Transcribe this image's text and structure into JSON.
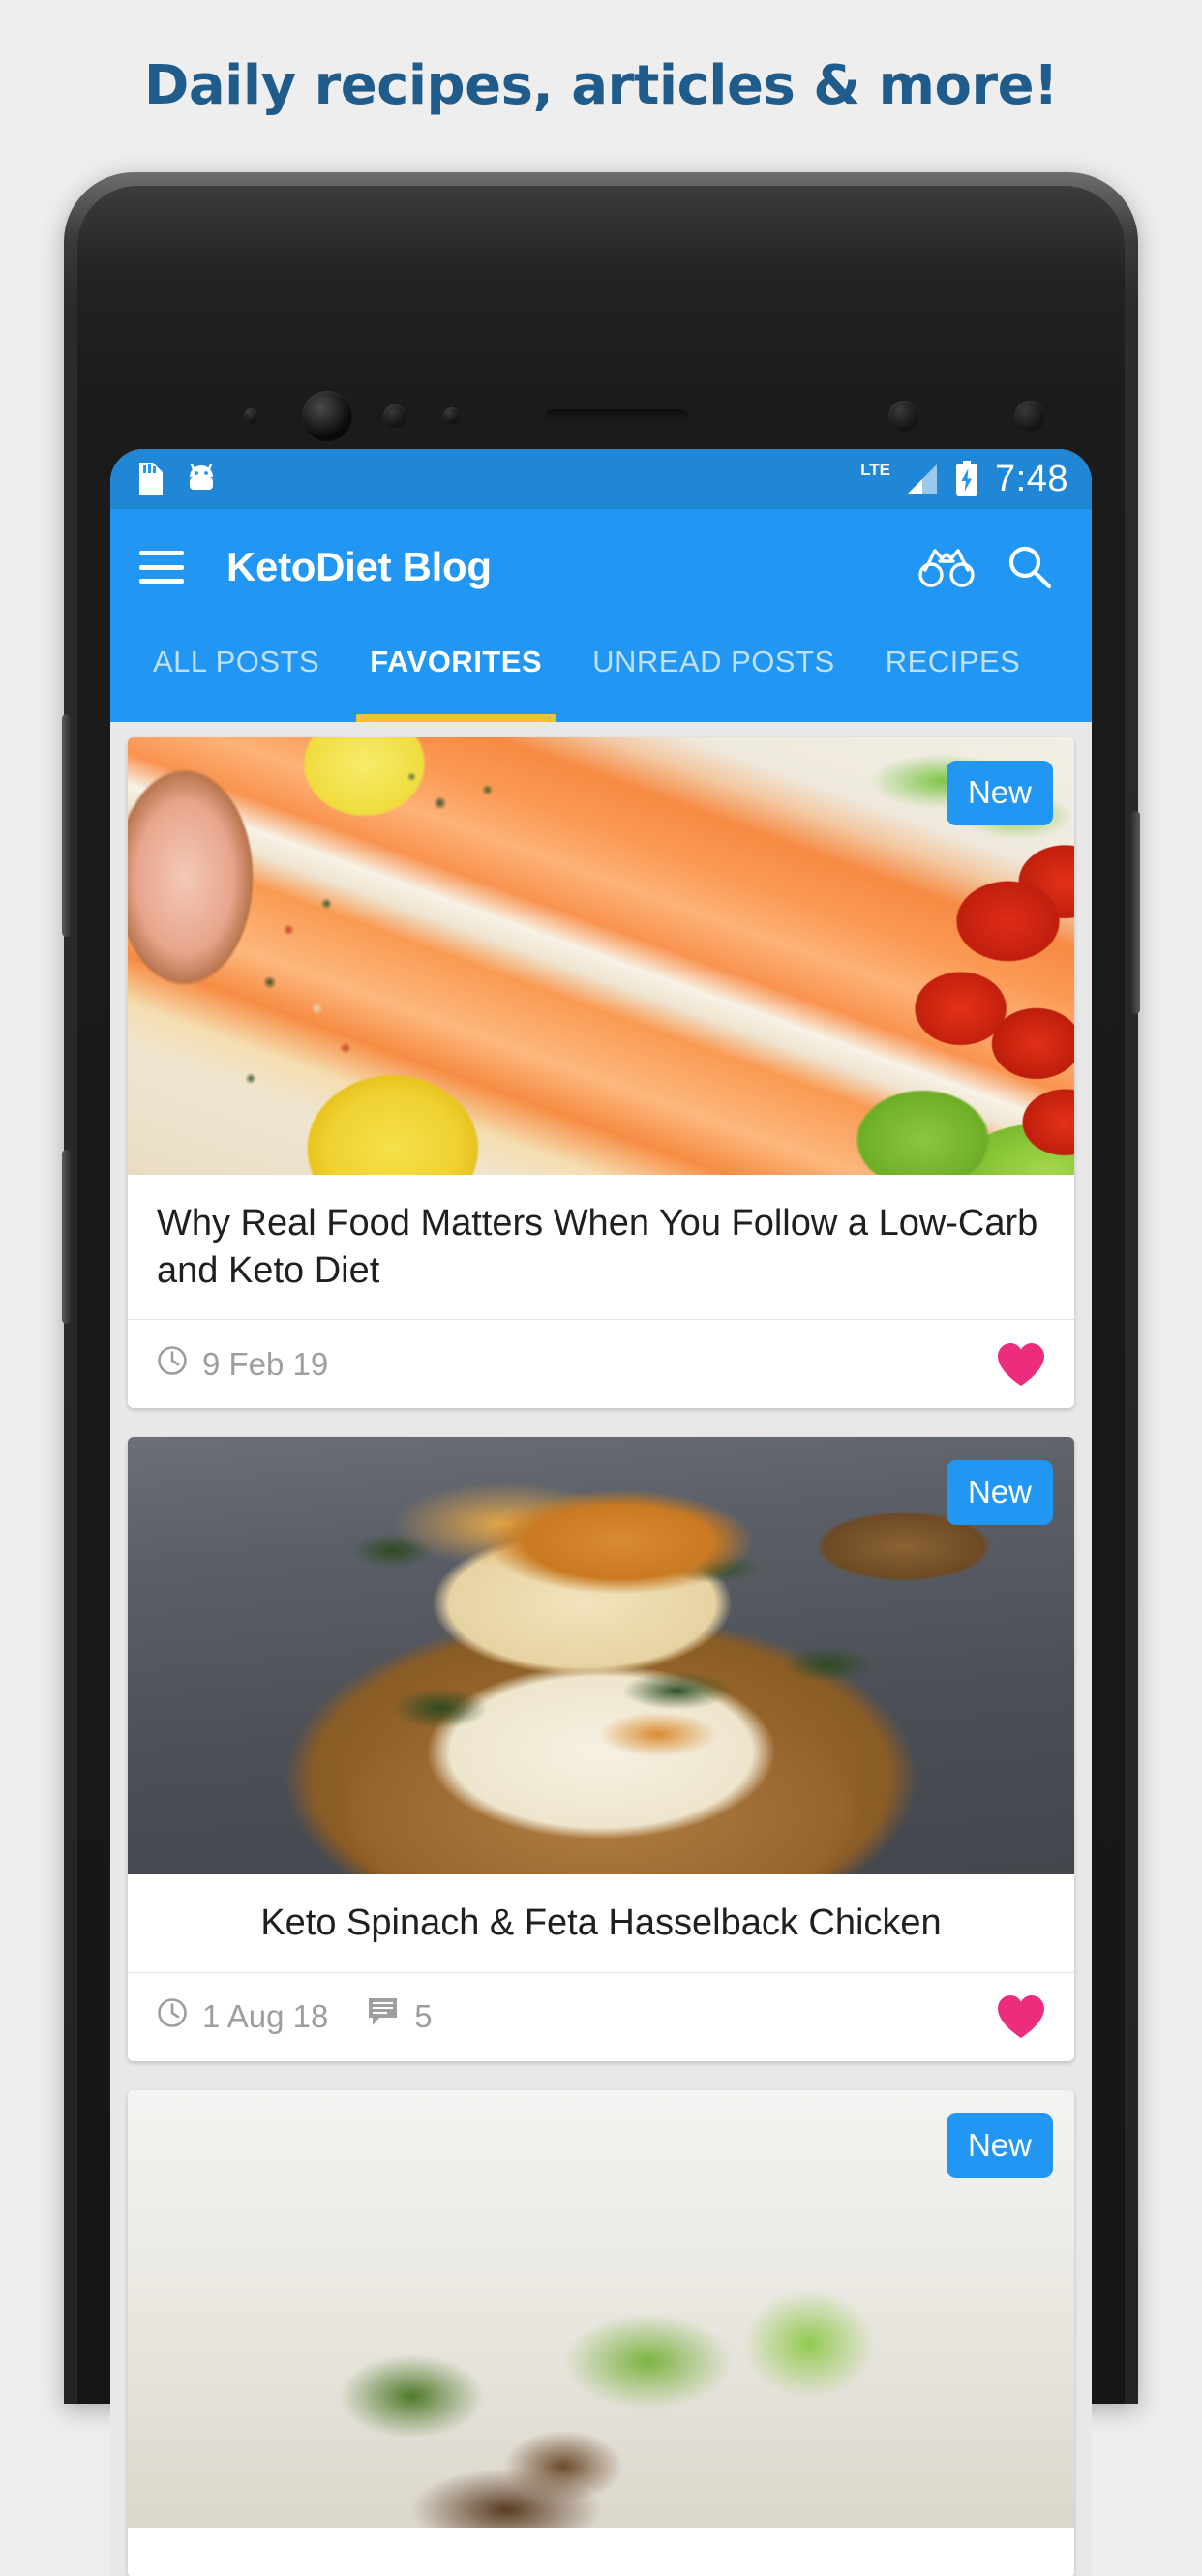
{
  "promo": {
    "headline": "Daily recipes, articles & more!",
    "headline_color": "#1F5C8B"
  },
  "status_bar": {
    "time": "7:48",
    "network_label": "LTE",
    "icons": [
      "sim-card-icon",
      "android-robot-icon",
      "signal-bars-icon",
      "battery-charging-icon"
    ]
  },
  "app_bar": {
    "title": "KetoDiet Blog",
    "menu_icon": "hamburger-menu-icon",
    "actions": [
      {
        "name": "binoculars-icon",
        "label": "Explore"
      },
      {
        "name": "search-icon",
        "label": "Search"
      }
    ],
    "background_color": "#2196f3"
  },
  "tabs": {
    "active_index": 1,
    "indicator_color": "#f5c132",
    "items": [
      {
        "label": "ALL POSTS"
      },
      {
        "label": "FAVORITES"
      },
      {
        "label": "UNREAD POSTS"
      },
      {
        "label": "RECIPES"
      }
    ]
  },
  "badges": {
    "new_label": "New",
    "new_color": "#2196f3"
  },
  "favorite_color": "#ec2d7e",
  "posts": [
    {
      "title": "Why Real Food Matters When You Follow a Low-Carb and Keto Diet",
      "date": "9 Feb 19",
      "comments": "",
      "badge": "New",
      "favorited": true,
      "image": "salmon-steaks-with-lemon-tomatoes-and-lettuce",
      "title_align": "left"
    },
    {
      "title": "Keto Spinach & Feta Hasselback Chicken",
      "date": "1 Aug 18",
      "comments": "5",
      "badge": "New",
      "favorited": true,
      "image": "hasselback-chicken-on-wooden-board",
      "title_align": "center"
    },
    {
      "title": "",
      "date": "",
      "comments": "",
      "badge": "New",
      "favorited": false,
      "image": "leafy-greens-growing-in-soil",
      "title_align": "left"
    }
  ]
}
